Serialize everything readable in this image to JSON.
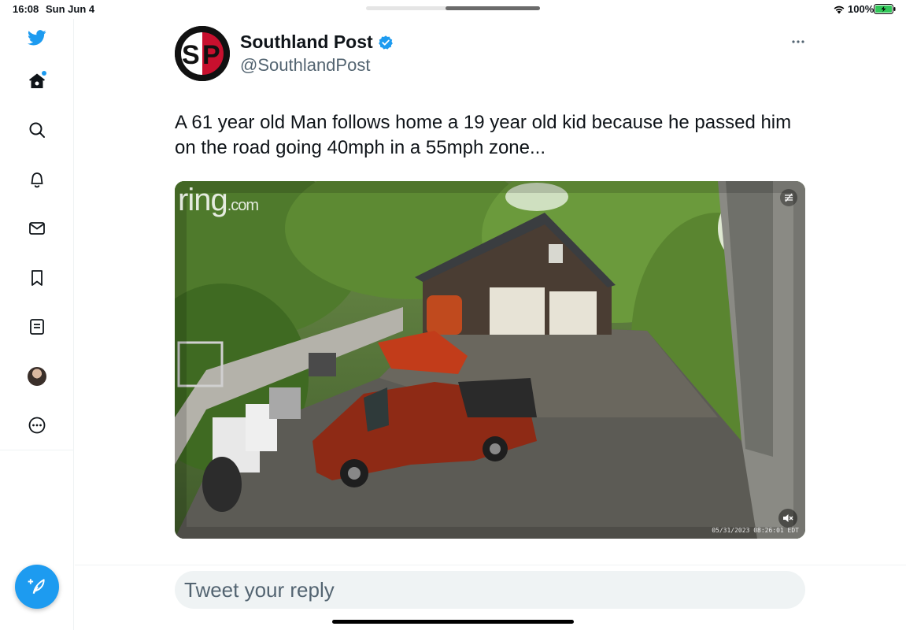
{
  "status_bar": {
    "time": "16:08",
    "date": "Sun Jun 4",
    "battery": "100%"
  },
  "sidebar": {
    "items": [
      {
        "name": "twitter-logo",
        "icon": "bird-icon"
      },
      {
        "name": "home",
        "icon": "home-icon",
        "has_dot": true
      },
      {
        "name": "explore",
        "icon": "search-icon"
      },
      {
        "name": "notifications",
        "icon": "bell-icon"
      },
      {
        "name": "messages",
        "icon": "envelope-icon"
      },
      {
        "name": "bookmarks",
        "icon": "bookmark-icon"
      },
      {
        "name": "lists",
        "icon": "list-icon"
      },
      {
        "name": "profile",
        "icon": "avatar"
      },
      {
        "name": "more",
        "icon": "more-circle-icon"
      }
    ],
    "compose_icon": "feather-plus-icon"
  },
  "tweet": {
    "author_name": "Southland Post",
    "author_handle": "@SouthlandPost",
    "verified": true,
    "avatar_text": "SP",
    "text": "A 61 year old Man follows home a 19 year old kid because he passed him on the road going 40mph in a 55mph zone...",
    "media": {
      "logo_main": "ring",
      "logo_suffix": ".com",
      "timestamp": "05/31/2023 08:26:01 EDT"
    }
  },
  "reply": {
    "placeholder": "Tweet your reply"
  },
  "colors": {
    "accent": "#1d9bf0",
    "text": "#0f1419",
    "secondary_text": "#536471",
    "divider": "#eff3f4",
    "avatar_red": "#c8102e"
  }
}
